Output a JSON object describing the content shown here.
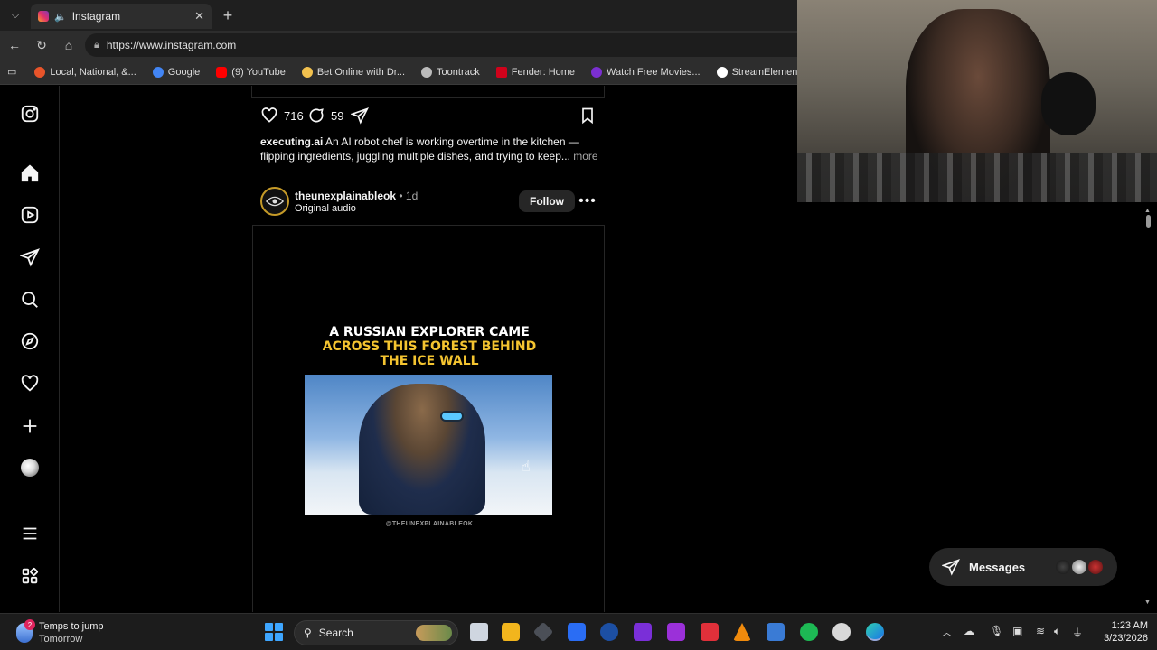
{
  "browser": {
    "tab_title": "Instagram",
    "url": "https://www.instagram.com",
    "bookmarks": [
      {
        "label": "Local, National, &...",
        "color": "#e8542a"
      },
      {
        "label": "Google",
        "color": "#4285f4"
      },
      {
        "label": "(9) YouTube",
        "color": "#ff0000"
      },
      {
        "label": "Bet Online with Dr...",
        "color": "#f2c14e"
      },
      {
        "label": "Toontrack",
        "color": "#bbbbbb"
      },
      {
        "label": "Fender: Home",
        "color": "#d0021b"
      },
      {
        "label": "Watch Free Movies...",
        "color": "#7b2fd1"
      },
      {
        "label": "StreamElements | T...",
        "color": "#ffffff"
      }
    ]
  },
  "previous_post": {
    "likes": "716",
    "comments": "59",
    "caption_user": "executing.ai",
    "caption_text": " An AI robot chef is working overtime in the kitchen — flipping ingredients, juggling multiple dishes, and trying to keep...",
    "caption_more": " more"
  },
  "post": {
    "username": "theunexplainableok",
    "time": " • 1d",
    "audio": "Original audio",
    "follow_label": "Follow",
    "more_label": "•••",
    "headline_line1": "A RUSSIAN EXPLORER CAME",
    "headline_line2": "ACROSS THIS FOREST BEHIND",
    "headline_line3": "THE ICE WALL",
    "watermark": "@THEUNEXPLAINABLEOK"
  },
  "messages": {
    "label": "Messages"
  },
  "taskbar": {
    "weather_line1": "Temps to jump",
    "weather_line2": "Tomorrow",
    "weather_badge": "2",
    "search_label": "Search",
    "time": "1:23 AM",
    "date": "3/23/2026"
  },
  "colors": {
    "headline_white": "#ffffff",
    "headline_yellow": "#f4c430",
    "accent_blue": "#3ea6ff"
  }
}
